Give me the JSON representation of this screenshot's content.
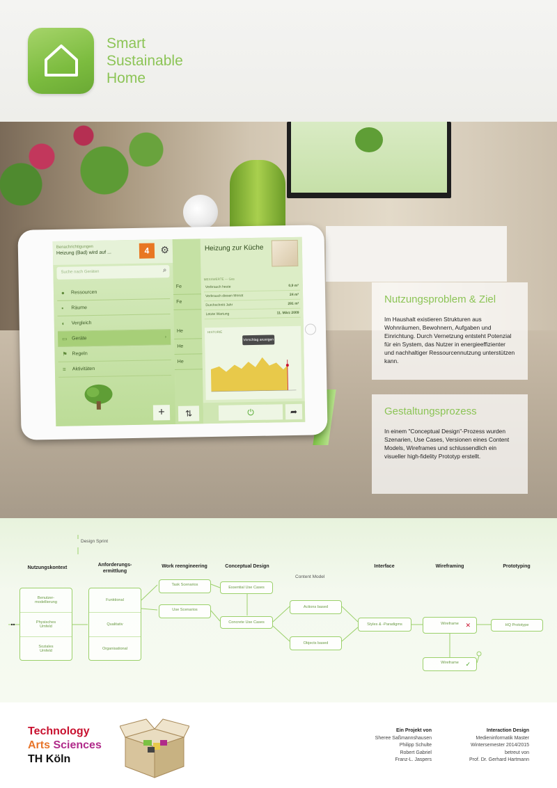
{
  "brand": {
    "line1": "Smart",
    "line2": "Sustainable",
    "line3": "Home"
  },
  "tablet": {
    "menu_top_line1": "Benachrichtigungen",
    "menu_top_line2": "Heizung (Bad) wird auf ...",
    "badge_count": "4",
    "search_placeholder": "Suche nach Geräten",
    "menu_items": [
      "Ressourcen",
      "Räume",
      "Vergleich",
      "Geräte",
      "Regeln",
      "Aktivitäten"
    ],
    "mid_items": [
      "Fe",
      "Fe",
      "He",
      "He",
      "He"
    ],
    "detail_title": "Heizung zur Küche",
    "section_label": "MESSWERTE — Gas",
    "rows": [
      {
        "label": "Verbrauch heute",
        "value": "0,9 m³"
      },
      {
        "label": "Verbrauch diesen Monat",
        "value": "24 m³"
      },
      {
        "label": "Durchschnitt Jahr",
        "value": "291 m³"
      },
      {
        "label": "Letzte Wartung",
        "value": "11. März 2009"
      }
    ],
    "chart_label": "HISTORIE",
    "tooltip": "Vorschlag anzeigen ›"
  },
  "cards": {
    "problem_title": "Nutzungsproblem & Ziel",
    "problem_text": "Im Haushalt existieren Strukturen aus Wohnräumen, Bewohnern, Aufgaben und Einrichtung. Durch Vernetzung entsteht Potenzial für ein System, das Nutzer in energieeffizienter und nachhaltiger Ressourcennutzung unterstützen kann.",
    "process_title": "Gestaltungsprozess",
    "process_text": "In einem \"Conceptual Design\"-Prozess wurden Szenarien, Use Cases, Versionen eines Content Models, Wireframes und schlussendlich ein visueller high-fidelity Prototyp erstellt."
  },
  "process": {
    "design_sprint": "Design Sprint",
    "phases": {
      "kontext": "Nutzungskontext",
      "anforderung": "Anforderungs-\nermittlung",
      "work": "Work reengineering",
      "conceptual": "Conceptual Design",
      "content_model": "Content Model",
      "interface": "Interface",
      "wireframing": "Wireframing",
      "prototyping": "Prototyping"
    },
    "kontext_cells": [
      "Benutzer-\nmodellierung",
      "Physisches\nUmfeld",
      "Soziales\nUmfeld"
    ],
    "anforderung_cells": [
      "Funktional",
      "Qualitativ",
      "Organisational"
    ],
    "task_scenarios": "Task Scenarios",
    "use_scenarios": "Use Scenarios",
    "essential_use_cases": "Essential Use Cases",
    "concrete_use_cases": "Concrete Use Cases",
    "actions_based": "Actions based",
    "objects_based": "Objects based",
    "styles_paradigms": "Styles & -Paradigms",
    "wireframe_1": "Wireframe",
    "wireframe_2": "Wireframe",
    "hq_prototype": "HQ Prototype"
  },
  "footer": {
    "tas_technology": "Technology",
    "tas_arts": "Arts",
    "tas_sciences": "Sciences",
    "th_koeln": "TH Köln",
    "project_head": "Ein Projekt von",
    "authors": [
      "Sheree Saßmannshausen",
      "Philipp Schulte",
      "Robert Gabriel",
      "Franz-L. Jaspers"
    ],
    "course_head": "Interaction Design",
    "course_lines": [
      "Medieninformatik Master",
      "Wintersemester 2014/2015",
      "betreut von",
      "Prof. Dr. Gerhard Hartmann"
    ]
  },
  "colors": {
    "accent_green": "#8cc456",
    "badge_orange": "#e87722",
    "tas_red": "#c8102e",
    "tas_orange": "#e8752a",
    "tas_purple": "#b02a8a"
  }
}
